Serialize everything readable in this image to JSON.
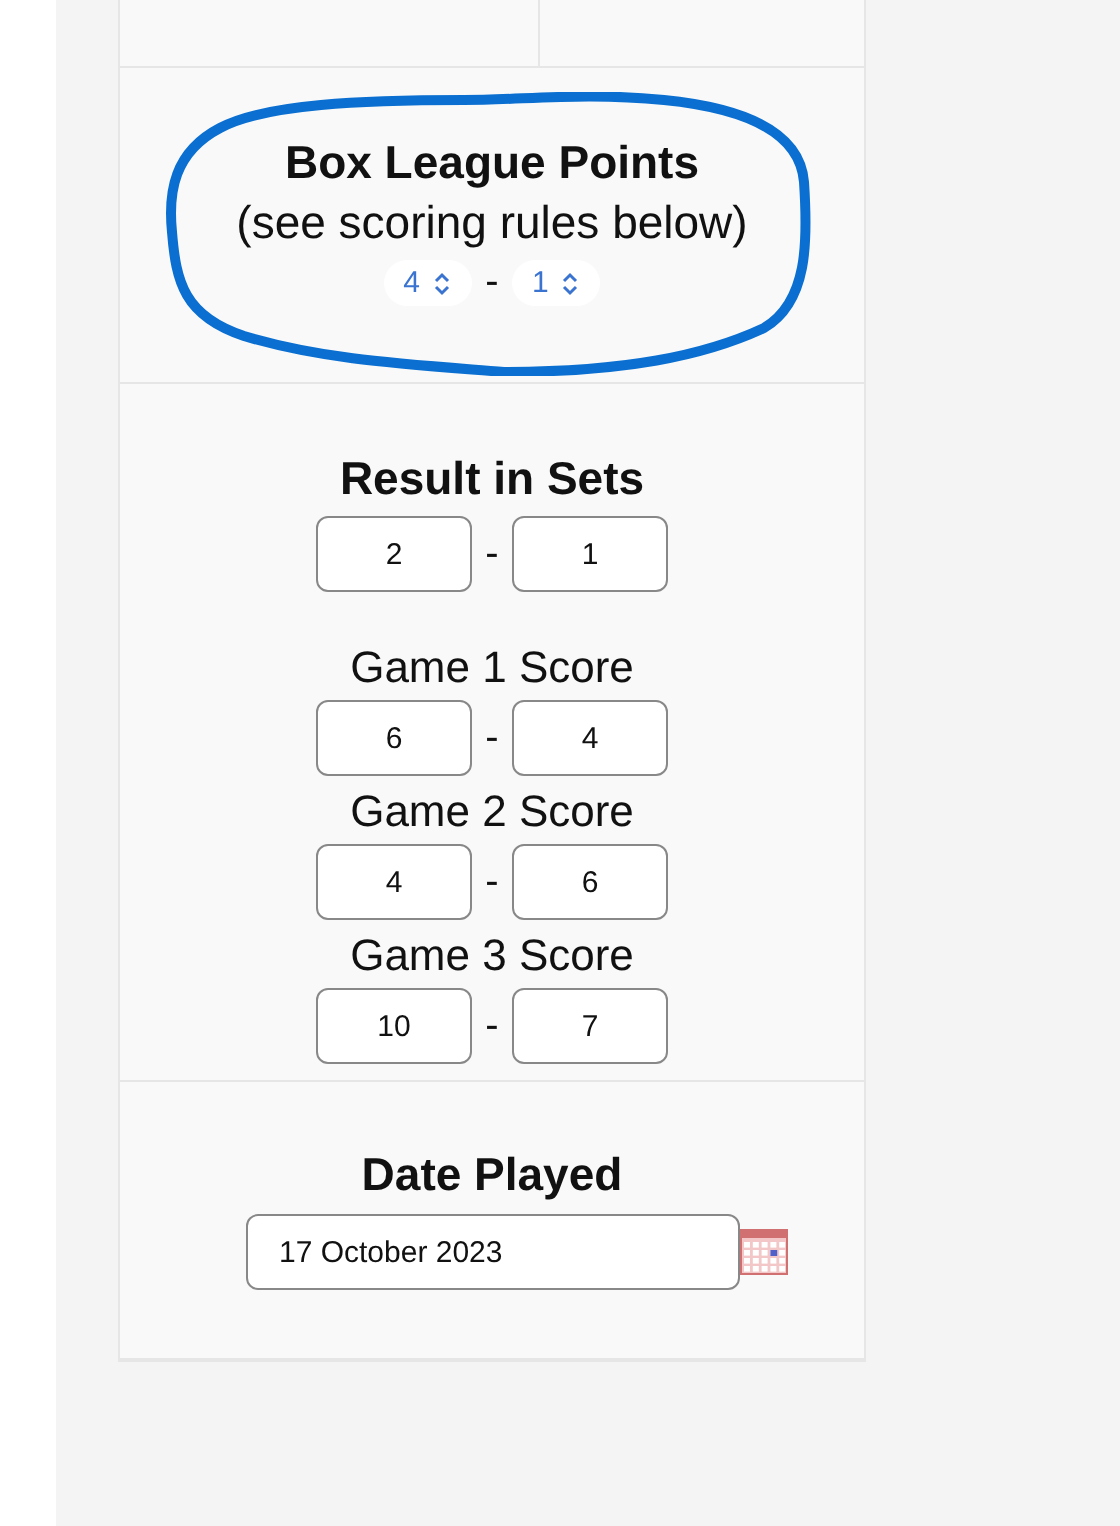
{
  "box_league_points": {
    "title": "Box League Points",
    "subtitle": "(see scoring rules below)",
    "separator": "-",
    "selects": [
      {
        "value": "4"
      },
      {
        "value": "1"
      }
    ]
  },
  "result_in_sets": {
    "title": "Result in Sets",
    "separator": "-",
    "values": [
      "2",
      "1"
    ]
  },
  "games": [
    {
      "label": "Game 1 Score",
      "separator": "-",
      "values": [
        "6",
        "4"
      ]
    },
    {
      "label": "Game 2 Score",
      "separator": "-",
      "values": [
        "4",
        "6"
      ]
    },
    {
      "label": "Game 3 Score",
      "separator": "-",
      "values": [
        "10",
        "7"
      ]
    }
  ],
  "date_played": {
    "title": "Date Played",
    "value": "17 October 2023"
  }
}
